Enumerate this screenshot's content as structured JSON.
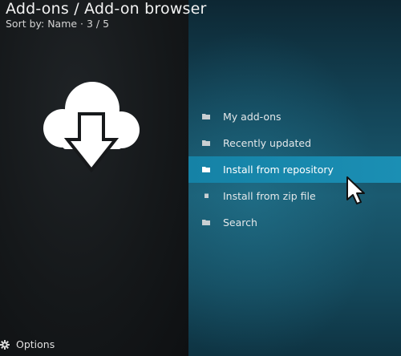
{
  "header": {
    "title": "Add-ons / Add-on browser",
    "subtitle": "Sort by: Name  ·  3 / 5"
  },
  "menu": {
    "items": [
      {
        "label": "My add-ons",
        "icon": "folder-icon",
        "selected": false
      },
      {
        "label": "Recently updated",
        "icon": "folder-icon",
        "selected": false
      },
      {
        "label": "Install from repository",
        "icon": "folder-icon",
        "selected": true
      },
      {
        "label": "Install from zip file",
        "icon": "file-icon",
        "selected": false
      },
      {
        "label": "Search",
        "icon": "folder-icon",
        "selected": false
      }
    ]
  },
  "footer": {
    "options_label": "Options",
    "options_icon": "gear-icon"
  },
  "artwork": {
    "icon": "cloud-download-icon"
  },
  "colors": {
    "selected_bg": "#1582a6",
    "text": "#e4e8ea",
    "left_bg": "#15181a",
    "right_bg": "#134457"
  }
}
